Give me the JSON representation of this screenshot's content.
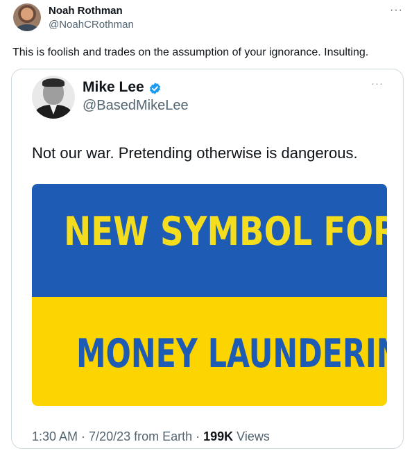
{
  "outer_tweet": {
    "name": "Noah Rothman",
    "handle": "@NoahCRothman",
    "more": "···",
    "text": "This is foolish and trades on the assumption of your ignorance. Insulting."
  },
  "quoted_tweet": {
    "name": "Mike Lee",
    "handle": "@BasedMikeLee",
    "more": "···",
    "text": "Not our war. Pretending otherwise is dangerous.",
    "image": {
      "line1": "NEW SYMBOL FOR",
      "line2": "MONEY LAUNDERING",
      "colors": {
        "blue": "#1e5bb5",
        "yellow": "#fcd400"
      }
    },
    "meta": {
      "time": "1:30 AM",
      "sep1": " · ",
      "date": "7/20/23",
      "source": " from Earth",
      "sep2": " · ",
      "views_count": "199K",
      "views_label": " Views"
    }
  },
  "colors": {
    "verified": "#1d9bf0",
    "secondary_text": "#536471",
    "border": "#cfd9de"
  }
}
